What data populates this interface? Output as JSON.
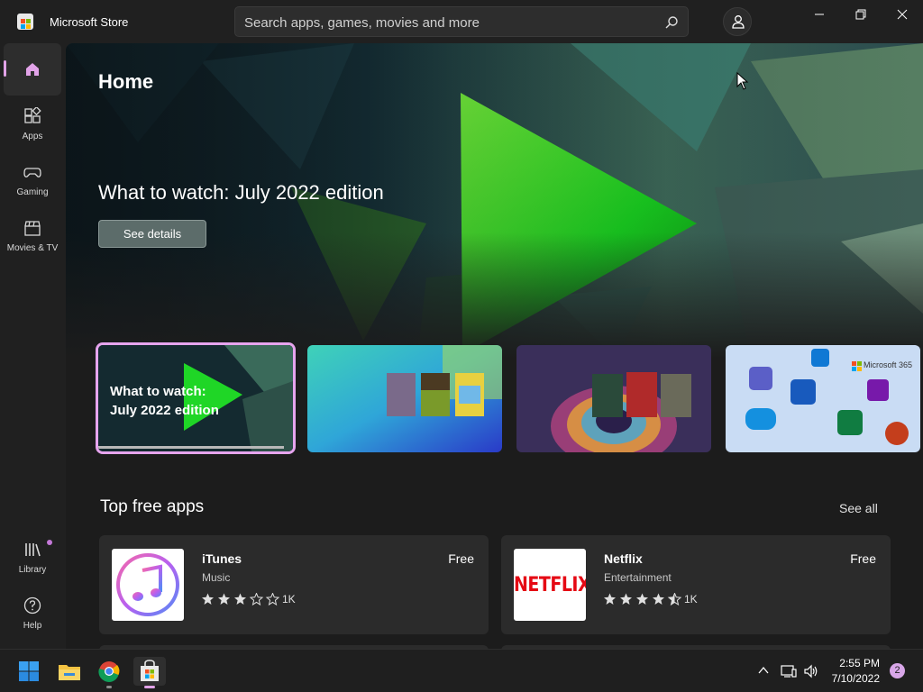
{
  "window": {
    "title": "Microsoft Store",
    "search_placeholder": "Search apps, games, movies and more"
  },
  "sidebar": {
    "items": [
      {
        "label": "Home",
        "icon": "home-icon",
        "active": true
      },
      {
        "label": "Apps",
        "icon": "apps-icon"
      },
      {
        "label": "Gaming",
        "icon": "gamepad-icon"
      },
      {
        "label": "Movies & TV",
        "icon": "clapper-icon"
      }
    ],
    "bottom": [
      {
        "label": "Library",
        "icon": "library-icon",
        "badge_dot": true
      },
      {
        "label": "Help",
        "icon": "help-icon"
      }
    ]
  },
  "hero": {
    "page_title": "Home",
    "headline": "What to watch: July 2022 edition",
    "button_label": "See details"
  },
  "carousel": [
    {
      "label_line1": "What to watch:",
      "label_line2": "July 2022 edition",
      "selected": true
    },
    {
      "label_line1": "",
      "label_line2": ""
    },
    {
      "label_line1": "",
      "label_line2": ""
    },
    {
      "label_line1": "Microsoft 365",
      "label_line2": ""
    }
  ],
  "top_free": {
    "title": "Top free apps",
    "see_all": "See all",
    "apps": [
      {
        "name": "iTunes",
        "category": "Music",
        "price": "Free",
        "stars": 3,
        "rating_count": "1K"
      },
      {
        "name": "Netflix",
        "category": "Entertainment",
        "price": "Free",
        "stars": 4.5,
        "rating_count": "1K",
        "logo_text": "NETFLIX"
      }
    ]
  },
  "taskbar": {
    "time": "2:55 PM",
    "date": "7/10/2022",
    "notifications": "2"
  },
  "colors": {
    "accent": "#e2a3e8",
    "background": "#202020",
    "card": "#2b2b2b",
    "netflix_red": "#e50914"
  }
}
